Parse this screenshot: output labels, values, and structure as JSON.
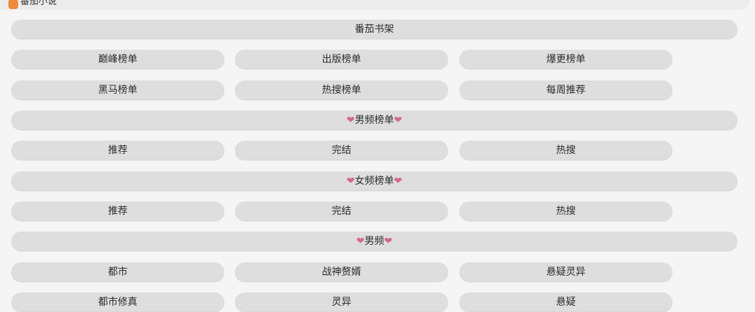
{
  "header": {
    "app_name": "番茄小说"
  },
  "heart_icon": "❤",
  "accent_color": "#d4688a",
  "rows": [
    {
      "type": "wide",
      "label": "番茄书架"
    },
    {
      "type": "triple",
      "items": [
        "巅峰榜单",
        "出版榜单",
        "爆更榜单"
      ]
    },
    {
      "type": "triple",
      "items": [
        "黑马榜单",
        "热搜榜单",
        "每周推荐"
      ]
    },
    {
      "type": "section",
      "label": "男频榜单"
    },
    {
      "type": "triple",
      "items": [
        "推荐",
        "完结",
        "热搜"
      ]
    },
    {
      "type": "section",
      "label": "女频榜单"
    },
    {
      "type": "triple",
      "items": [
        "推荐",
        "完结",
        "热搜"
      ]
    },
    {
      "type": "section",
      "label": "男频"
    },
    {
      "type": "triple",
      "items": [
        "都市",
        "战神赘婿",
        "悬疑灵异"
      ]
    },
    {
      "type": "triple",
      "items": [
        "都市修真",
        "灵异",
        "悬疑"
      ]
    }
  ]
}
